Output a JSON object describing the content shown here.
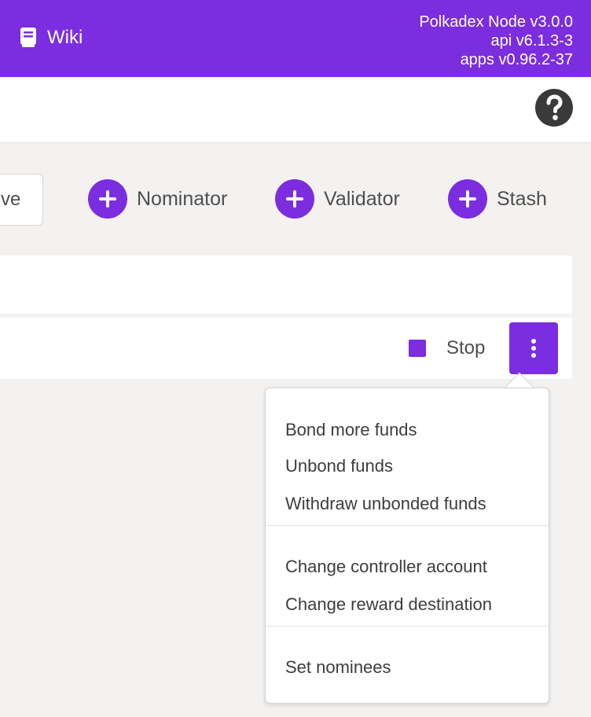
{
  "header": {
    "wiki_icon": "book-icon",
    "wiki_label": "Wiki",
    "node_name": "Polkadex Node v3.0.0",
    "api_version": "api v6.1.3-3",
    "apps_version": "apps v0.96.2-37",
    "accent_color": "#7b2ddf"
  },
  "subheader": {
    "help_icon": "question-circle-icon"
  },
  "actions": {
    "partial_button_label": "ve",
    "add_nominator_label": "Nominator",
    "add_validator_label": "Validator",
    "add_stash_label": "Stash"
  },
  "row": {
    "stop_label": "Stop",
    "menu_icon": "vertical-ellipsis-icon"
  },
  "menu": {
    "group1": [
      "Bond more funds",
      "Unbond funds",
      "Withdraw unbonded funds"
    ],
    "group2": [
      "Change controller account",
      "Change reward destination"
    ],
    "group3": [
      "Set nominees"
    ]
  }
}
